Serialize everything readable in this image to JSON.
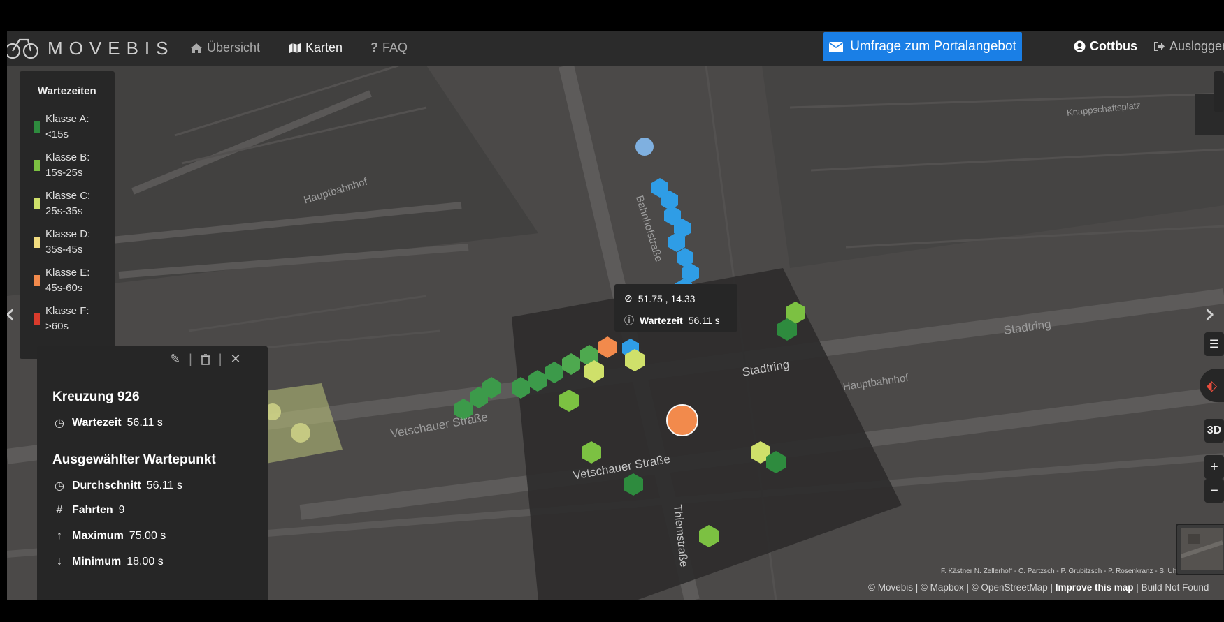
{
  "navbar": {
    "logo_text": "MOVEBIS",
    "links": [
      {
        "label": "Übersicht",
        "icon": "home-icon"
      },
      {
        "label": "Karten",
        "icon": "map-icon"
      },
      {
        "label": "FAQ",
        "icon": "question-icon"
      }
    ],
    "survey_button": "Umfrage zum Portalangebot",
    "city": "Cottbus",
    "logout": "Ausloggen"
  },
  "legend": {
    "title": "Wartezeiten",
    "items": [
      {
        "label": "Klasse A: <15s",
        "color": "#2e8b3e"
      },
      {
        "label": "Klasse B: 15s-25s",
        "color": "#7cc142"
      },
      {
        "label": "Klasse C: 25s-35s",
        "color": "#cfe06a"
      },
      {
        "label": "Klasse D: 35s-45s",
        "color": "#f2dc80"
      },
      {
        "label": "Klasse E: 45s-60s",
        "color": "#f28a4c"
      },
      {
        "label": "Klasse F: >60s",
        "color": "#d93b2c"
      }
    ]
  },
  "panel": {
    "title": "Kreuzung 926",
    "wartezeit_label": "Wartezeit",
    "wartezeit_value": "56.11 s",
    "section_title": "Ausgewählter Wartepunkt",
    "stats": [
      {
        "icon": "clock-icon",
        "label": "Durchschnitt",
        "value": "56.11 s"
      },
      {
        "icon": "hash-icon",
        "label": "Fahrten",
        "value": "9"
      },
      {
        "icon": "arrow-up-icon",
        "label": "Maximum",
        "value": "75.00 s"
      },
      {
        "icon": "arrow-down-icon",
        "label": "Minimum",
        "value": "18.00 s"
      }
    ]
  },
  "tooltip": {
    "coords": "51.75 , 14.33",
    "label": "Wartezeit",
    "value": "56.11 s"
  },
  "map_labels": {
    "hauptbahnhof_1": "Hauptbahnhof",
    "hauptbahnhof_2": "Hauptbahnhof",
    "bahnhofstrasse": "Bahnhofstraße",
    "stadtring_1": "Stadtring",
    "stadtring_2": "Stadtring",
    "vetschauer_1": "Vetschauer Straße",
    "vetschauer_2": "Vetschauer Straße",
    "thiemstrasse": "Thiemstraße",
    "knappschaftsplatz": "Knappschaftsplatz"
  },
  "controls": {
    "three_d": "3D",
    "zoom_in": "+",
    "zoom_out": "−"
  },
  "attribution": {
    "movebis": "© Movebis",
    "mapbox": "© Mapbox",
    "osm": "© OpenStreetMap",
    "improve": "Improve this map",
    "build": "Build Not Found"
  },
  "credits": "F. Kästner   N. Zellerhoff - C. Partzsch - P. Grubitzsch - P. Rosenkranz - S. Uh"
}
